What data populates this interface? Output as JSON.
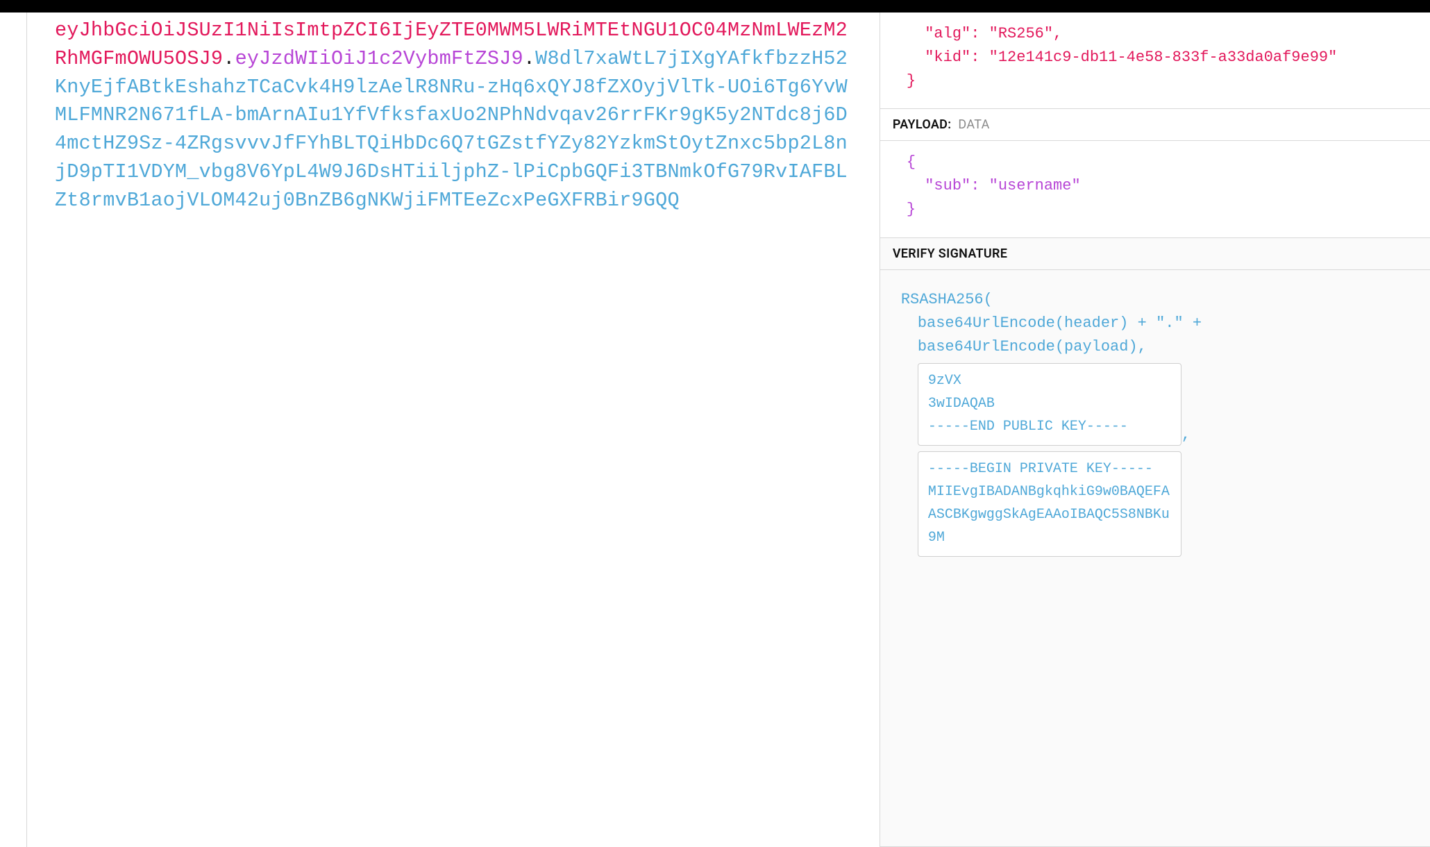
{
  "encoded": {
    "header": "eyJhbGciOiJSUzI1NiIsImtpZCI6IjEyZTE0MWM5LWRiMTEtNGU1OC04MzNmLWEzM2RhMGFmOWU5OSJ9",
    "payload": "eyJzdWIiOiJ1c2VybmFtZSJ9",
    "signature": "W8dl7xaWtL7jIXgYAfkfbzzH52KnyEjfABtkEshahzTCaCvk4H9lzAelR8NRu-zHq6xQYJ8fZXOyjVlTk-UOi6Tg6YvWMLFMNR2N671fLA-bmArnAIu1YfVfksfaxUo2NPhNdvqav26rrFKr9gK5y2NTdc8j6D4mctHZ9Sz-4ZRgsvvvJfFYhBLTQiHbDc6Q7tGZstfYZy82YzkmStOytZnxc5bp2L8njD9pTI1VDYM_vbg8V6YpL4W9J6DsHTiiljphZ-lPiCpbGQFi3TBNmkOfG79RvIAFBLZt8rmvB1aojVLOM42uj0BnZB6gNKWjiFMTEeZcxPeGXFRBir9GQQ"
  },
  "decoded": {
    "header_json": "  \"alg\": \"RS256\",\n  \"kid\": \"12e141c9-db11-4e58-833f-a33da0af9e99\"\n}",
    "payload_label": "PAYLOAD:",
    "payload_sub": "DATA",
    "payload_json": "{\n  \"sub\": \"username\"\n}",
    "verify_label": "VERIFY SIGNATURE",
    "sig": {
      "fn": "RSASHA256(",
      "line1": "base64UrlEncode(header) + \".\" +",
      "line2": "base64UrlEncode(payload),",
      "public_key": "9zVX\n3wIDAQAB\n-----END PUBLIC KEY-----",
      "comma": ",",
      "private_key": "-----BEGIN PRIVATE KEY-----\nMIIEvgIBADANBgkqhkiG9w0BAQEFAASCBKgwggSkAgEAAoIBAQC5S8NBKu9M"
    }
  }
}
